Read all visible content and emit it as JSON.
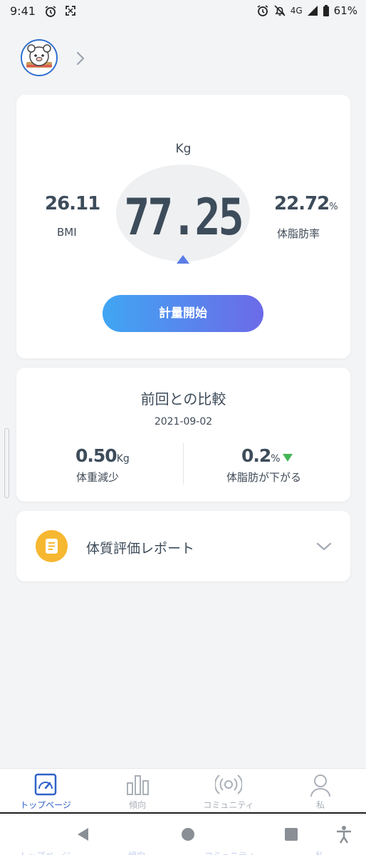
{
  "status_bar": {
    "time": "9:41",
    "network": "4G",
    "battery": "61%",
    "icons": [
      "alarm-icon",
      "screenshot-icon",
      "alarm-icon",
      "mute-icon",
      "signal-icon",
      "battery-icon"
    ]
  },
  "profile": {
    "avatar": "avatar",
    "chevron": "chevron-right-icon"
  },
  "measurement": {
    "unit": "Kg",
    "weight": "77.25",
    "bmi_value": "26.11",
    "bmi_label": "BMI",
    "body_fat_value": "22.72",
    "body_fat_unit": "%",
    "body_fat_label": "体脂肪率",
    "start_button": "計量開始"
  },
  "comparison": {
    "title": "前回との比較",
    "date": "2021-09-02",
    "weight_change_value": "0.50",
    "weight_change_unit": "Kg",
    "weight_change_label": "体重減少",
    "fat_change_value": "0.2",
    "fat_change_unit": "%",
    "fat_change_label": "体脂肪が下がる",
    "fat_trend_color": "#44b556"
  },
  "report": {
    "label": "体質評価レポート",
    "icon": "document-icon",
    "icon_color": "#f6b731"
  },
  "bottom_nav": {
    "items": [
      {
        "label": "トップページ",
        "icon": "gauge-icon",
        "active": true
      },
      {
        "label": "傾向",
        "icon": "bar-chart-icon",
        "active": false
      },
      {
        "label": "コミュニティ",
        "icon": "broadcast-icon",
        "active": false
      },
      {
        "label": "私",
        "icon": "person-icon",
        "active": false
      }
    ]
  },
  "system_nav": {
    "icons": [
      "back-icon",
      "home-icon",
      "recents-icon",
      "accessibility-icon"
    ]
  },
  "colors": {
    "accent": "#2f62c8",
    "button_start": "#40a6f3",
    "button_end": "#6c6ae8",
    "pointer": "#5b7de6"
  }
}
